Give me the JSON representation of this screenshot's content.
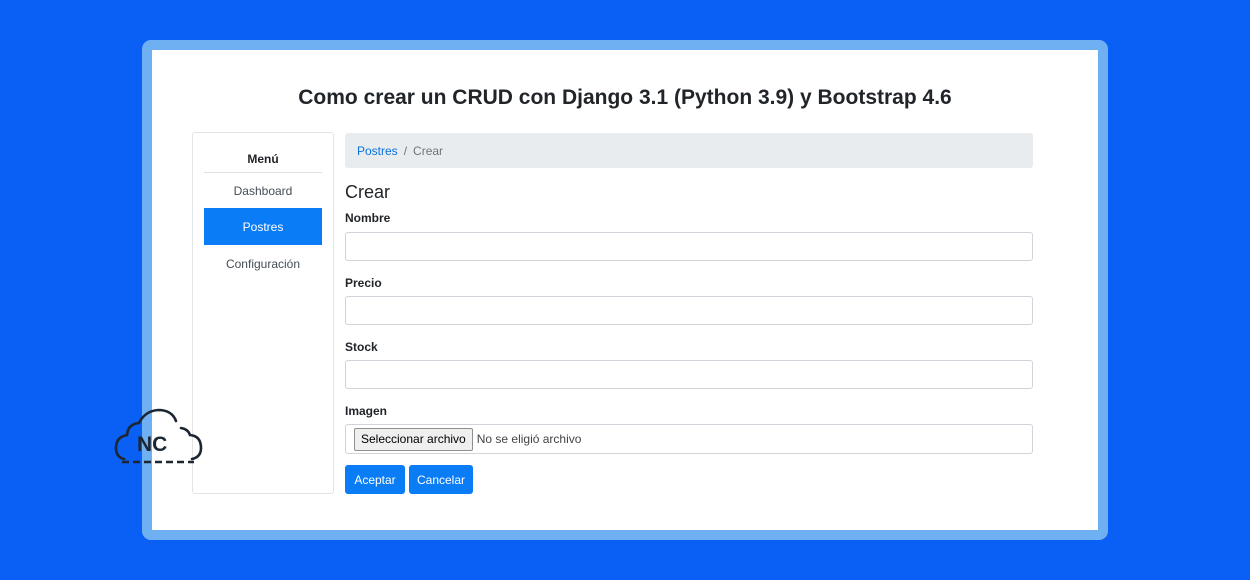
{
  "page": {
    "title": "Como crear un CRUD con Django 3.1 (Python 3.9) y Bootstrap 4.6"
  },
  "sidebar": {
    "header": "Menú",
    "items": [
      {
        "label": "Dashboard",
        "active": false
      },
      {
        "label": "Postres",
        "active": true
      },
      {
        "label": "Configuración",
        "active": false
      }
    ]
  },
  "breadcrumb": {
    "link": "Postres",
    "separator": "/",
    "current": "Crear"
  },
  "form": {
    "heading": "Crear",
    "fields": [
      {
        "label": "Nombre",
        "value": "",
        "placeholder": ""
      },
      {
        "label": "Precio",
        "value": "",
        "placeholder": ""
      },
      {
        "label": "Stock",
        "value": "",
        "placeholder": ""
      }
    ],
    "image": {
      "label": "Imagen",
      "button_label": "Seleccionar archivo",
      "status": "No se eligió archivo"
    },
    "submit_label": "Aceptar",
    "cancel_label": "Cancelar"
  },
  "logo": {
    "text": "NC",
    "icon": "cloud-icon"
  },
  "colors": {
    "background": "#0a5ff5",
    "frame": "#6fb0f3",
    "primary": "#0a7cf6",
    "breadcrumb_bg": "#e9ecef"
  }
}
